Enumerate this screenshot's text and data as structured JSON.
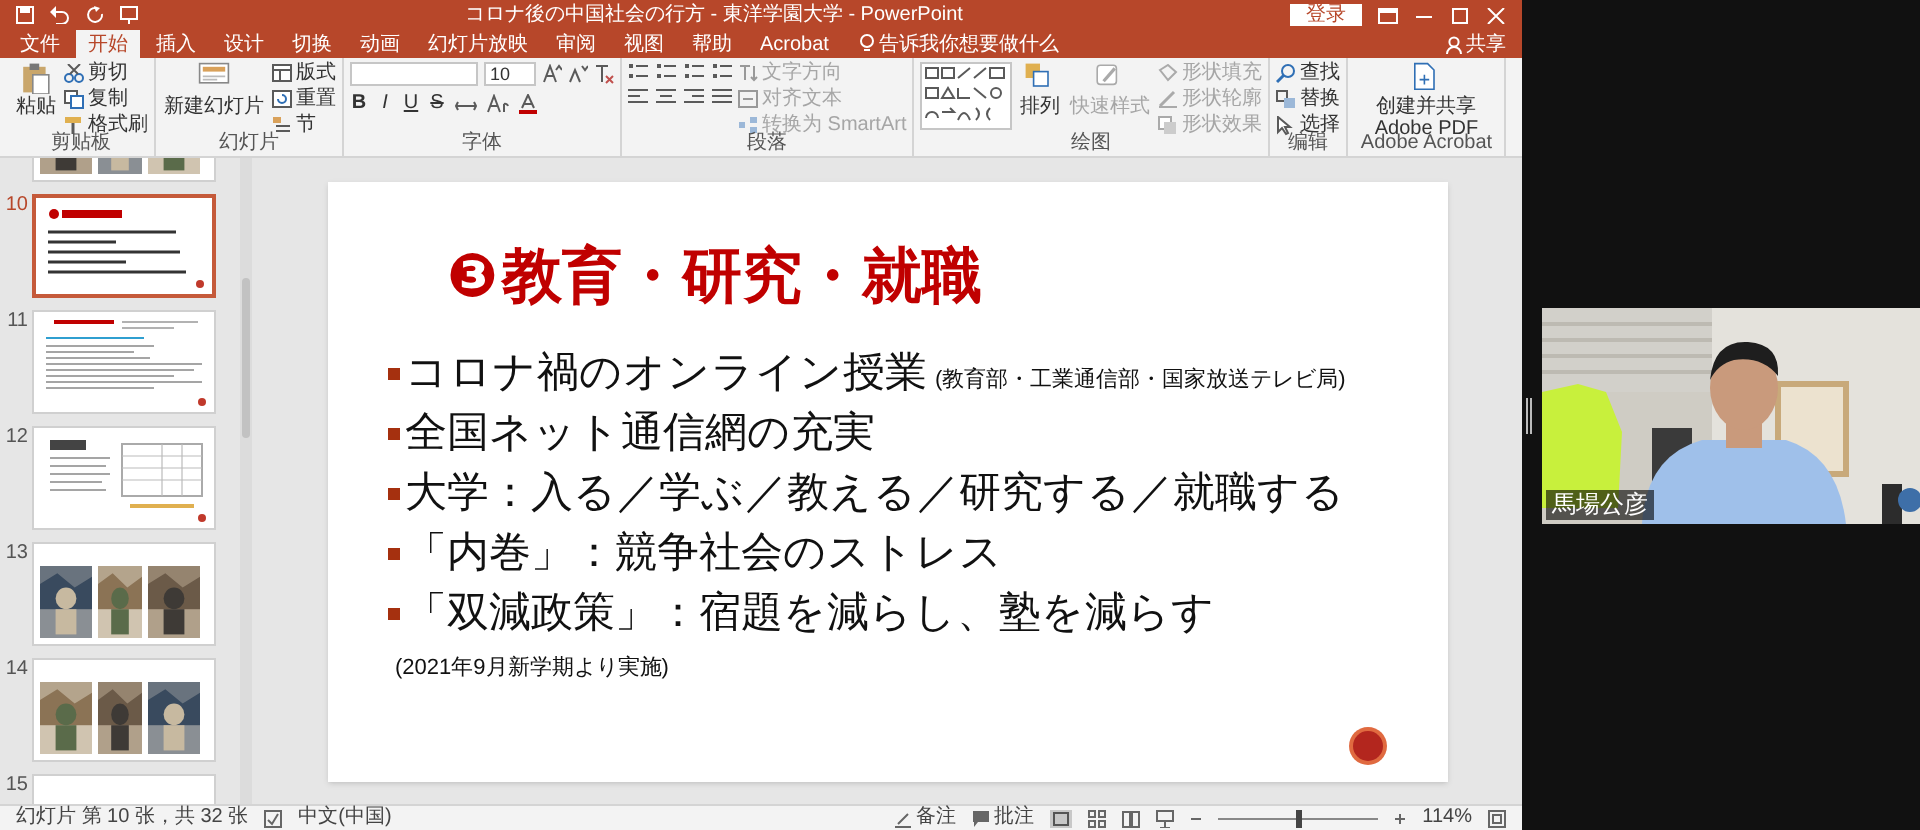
{
  "window": {
    "title": "コロナ後の中国社会の行方 - 東洋学園大学 - PowerPoint"
  },
  "account": {
    "sign_in": "登录",
    "share": "共享"
  },
  "tabs": [
    {
      "label": "文件",
      "selected": false
    },
    {
      "label": "开始",
      "selected": true
    },
    {
      "label": "插入",
      "selected": false
    },
    {
      "label": "设计",
      "selected": false
    },
    {
      "label": "切换",
      "selected": false
    },
    {
      "label": "动画",
      "selected": false
    },
    {
      "label": "幻灯片放映",
      "selected": false
    },
    {
      "label": "审阅",
      "selected": false
    },
    {
      "label": "视图",
      "selected": false
    },
    {
      "label": "帮助",
      "selected": false
    },
    {
      "label": "Acrobat",
      "selected": false
    }
  ],
  "tell_me": {
    "placeholder": "告诉我你想要做什么"
  },
  "ribbon_groups": [
    {
      "label": "剪贴板",
      "kind": "buttons",
      "items": [
        {
          "label": "粘贴",
          "kind": "large",
          "disabled": false
        },
        {
          "label": "剪切",
          "kind": "small",
          "disabled": false
        },
        {
          "label": "复制",
          "kind": "small",
          "disabled": false
        },
        {
          "label": "格式刷",
          "kind": "small",
          "disabled": false
        }
      ]
    },
    {
      "label": "幻灯片",
      "kind": "buttons",
      "items": [
        {
          "label": "新建幻灯片",
          "kind": "large",
          "disabled": false
        },
        {
          "label": "版式",
          "kind": "small",
          "disabled": false
        },
        {
          "label": "重置",
          "kind": "small",
          "disabled": false
        },
        {
          "label": "节",
          "kind": "small",
          "disabled": false
        }
      ]
    },
    {
      "label": "字体",
      "kind": "font",
      "font_size": "10",
      "format_buttons": [
        "B",
        "I",
        "U",
        "S"
      ]
    },
    {
      "label": "段落",
      "kind": "paragraph",
      "items": [
        {
          "label": "文字方向",
          "kind": "small",
          "disabled": true
        },
        {
          "label": "对齐文本",
          "kind": "small",
          "disabled": true
        },
        {
          "label": "转换为 SmartArt",
          "kind": "small",
          "disabled": true
        }
      ]
    },
    {
      "label": "绘图",
      "kind": "drawing",
      "items": [
        {
          "label": "排列",
          "kind": "large",
          "disabled": false
        },
        {
          "label": "快速样式",
          "kind": "large",
          "disabled": true
        },
        {
          "label": "形状填充",
          "kind": "small",
          "disabled": true
        },
        {
          "label": "形状轮廓",
          "kind": "small",
          "disabled": true
        },
        {
          "label": "形状效果",
          "kind": "small",
          "disabled": true
        }
      ]
    },
    {
      "label": "编辑",
      "kind": "buttons",
      "items": [
        {
          "label": "查找",
          "kind": "small",
          "disabled": false
        },
        {
          "label": "替换",
          "kind": "small",
          "disabled": false
        },
        {
          "label": "选择",
          "kind": "small",
          "disabled": false
        }
      ]
    },
    {
      "label": "Adobe Acrobat",
      "kind": "buttons",
      "items": [
        {
          "label": "创建并共享 Adobe PDF",
          "kind": "large",
          "disabled": false
        }
      ]
    }
  ],
  "thumbnails": [
    {
      "kind": "photos",
      "selected": false
    },
    {
      "number": "10",
      "kind": "title",
      "selected": true
    },
    {
      "number": "11",
      "kind": "text",
      "selected": false
    },
    {
      "number": "12",
      "kind": "table",
      "selected": false
    },
    {
      "number": "13",
      "kind": "photos",
      "selected": false
    },
    {
      "number": "14",
      "kind": "photos",
      "selected": false
    },
    {
      "number": "15",
      "kind": "blank",
      "selected": false
    }
  ],
  "slide": {
    "title_number": "❸",
    "title": "教育・研究・就職",
    "bullets": [
      {
        "text": "コロナ禍のオンライン授業",
        "note": "(教育部・工業通信部・国家放送テレビ局)"
      },
      {
        "text": "全国ネット通信網の充実"
      },
      {
        "text": "大学：入る／学ぶ／教える／研究する／就職する"
      },
      {
        "text": "「内巻」：競争社会のストレス"
      },
      {
        "text": "「双減政策」：宿題を減らし、塾を減らす",
        "note": "(2021年9月新学期より実施)"
      }
    ]
  },
  "status_bar": {
    "slide_position": "幻灯片 第 10 张，共 32 张",
    "language": "中文(中国)",
    "notes": "备注",
    "comments": "批注",
    "zoom": "114%",
    "zoom_slider": {
      "level": 0.5
    }
  },
  "participant": {
    "name": "馬場公彦"
  }
}
